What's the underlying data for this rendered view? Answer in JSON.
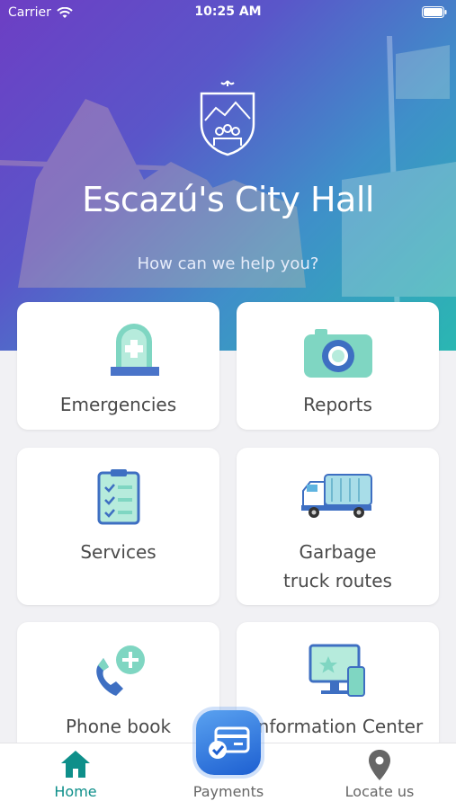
{
  "status_bar": {
    "carrier": "Carrier",
    "time": "10:25 AM"
  },
  "header": {
    "title": "Escazú's City Hall",
    "subtitle": "How can we help you?"
  },
  "cards": {
    "emergencies": "Emergencies",
    "reports": "Reports",
    "services": "Services",
    "garbage_line1": "Garbage",
    "garbage_line2": "truck routes",
    "phone_book": "Phone book",
    "information_center": "Information Center"
  },
  "icons": {
    "emergencies": "tombstone-cross-icon",
    "reports": "camera-icon",
    "services": "clipboard-checklist-icon",
    "garbage": "garbage-truck-icon",
    "phone_book": "phone-add-icon",
    "information_center": "monitor-phone-icon",
    "home": "home-icon",
    "payments": "credit-card-check-icon",
    "locate": "map-pin-icon"
  },
  "tabbar": {
    "home": "Home",
    "payments": "Payments",
    "locate": "Locate us"
  },
  "colors": {
    "accent": "#0e8f8a",
    "gradient_start": "#6d3ec4",
    "gradient_end": "#2ab7b2",
    "icon_teal": "#7fd6c2",
    "icon_blue": "#3e6fc2"
  }
}
